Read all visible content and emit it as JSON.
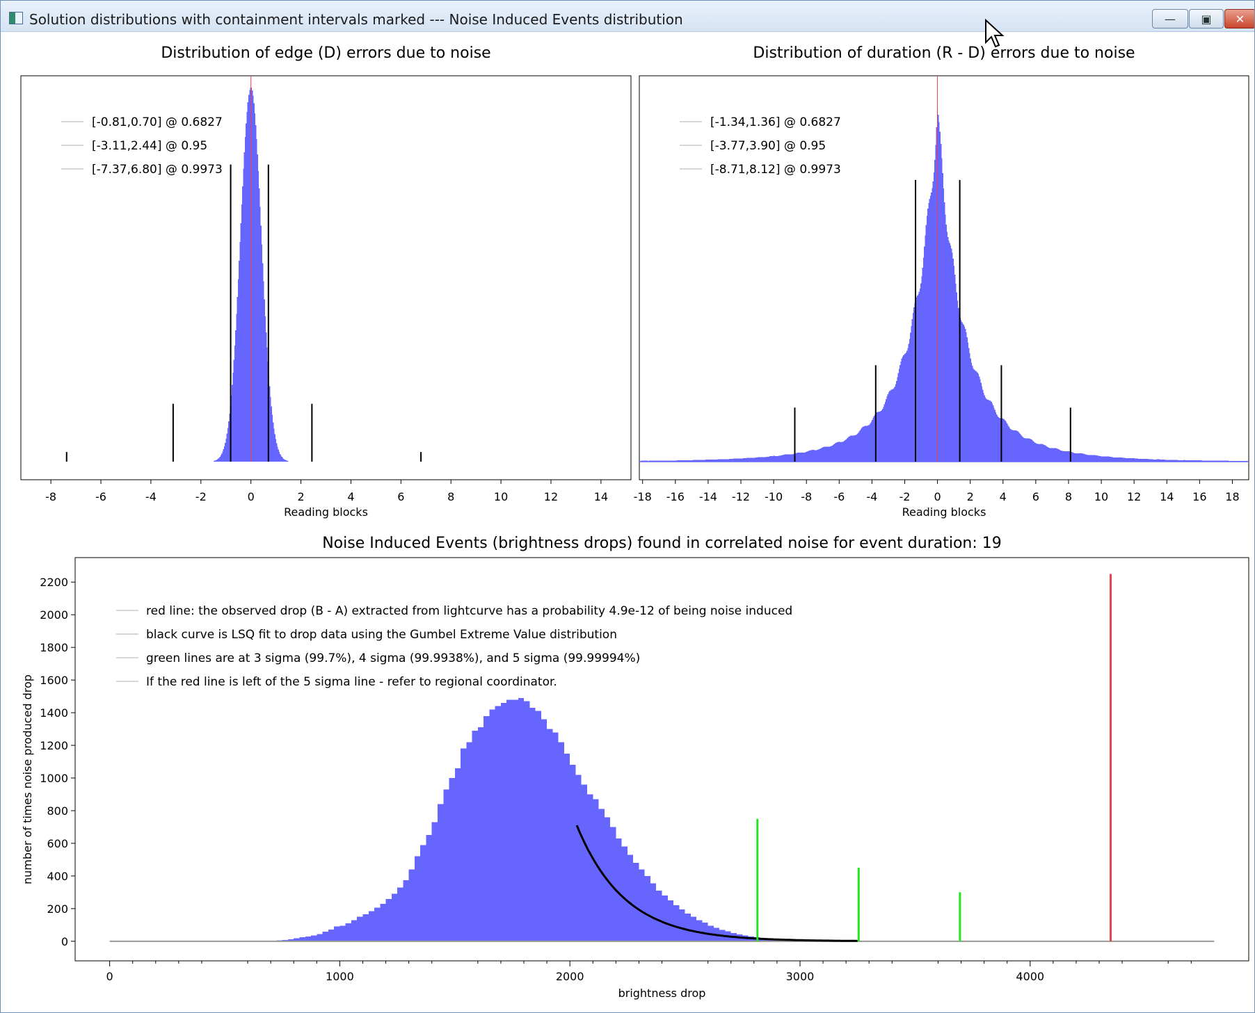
{
  "window": {
    "title": "Solution distributions with containment intervals marked --- Noise Induced Events distribution",
    "minimize_glyph": "—",
    "maximize_glyph": "▣",
    "close_glyph": "✕"
  },
  "colors": {
    "histogram": "#6666ff",
    "interval_lines": "#000000",
    "center_line": "#e8424b",
    "observed_drop_line": "#e8424b",
    "sigma_lines": "#22e622",
    "fit_curve": "#000000",
    "baseline": "#999999"
  },
  "chart_data": [
    {
      "type": "bar",
      "title": "Distribution of edge (D) errors due to noise",
      "xlabel": "Reading blocks",
      "ylabel": "",
      "xlim": [
        -9.2,
        15.2
      ],
      "xticks": [
        -8,
        -6,
        -4,
        -2,
        0,
        2,
        4,
        6,
        8,
        10,
        12,
        14
      ],
      "grid": false,
      "legend_position": "top-left",
      "legend": [
        "[-0.81,0.70] @ 0.6827",
        "[-3.11,2.44] @ 0.95",
        "[-7.37,6.80] @ 0.9973"
      ],
      "histogram": {
        "shape": "normal",
        "center": 0.0,
        "sigma": 0.42,
        "peak_fraction": 0.97
      },
      "center_line": 0,
      "intervals": [
        {
          "confidence": 0.6827,
          "low": -0.81,
          "high": 0.7,
          "height_fraction": 0.77
        },
        {
          "confidence": 0.95,
          "low": -3.11,
          "high": 2.44,
          "height_fraction": 0.15
        },
        {
          "confidence": 0.9973,
          "low": -7.37,
          "high": 6.8,
          "height_fraction": 0.025
        }
      ]
    },
    {
      "type": "bar",
      "title": "Distribution of duration (R - D) errors due to noise",
      "xlabel": "Reading blocks",
      "ylabel": "",
      "xlim": [
        -18.2,
        19.0
      ],
      "xticks": [
        -18,
        -16,
        -14,
        -12,
        -10,
        -8,
        -6,
        -4,
        -2,
        0,
        2,
        4,
        6,
        8,
        10,
        12,
        14,
        16,
        18
      ],
      "grid": false,
      "legend_position": "top-left",
      "legend": [
        "[-1.34,1.36] @ 0.6827",
        "[-3.77,3.90] @ 0.95",
        "[-8.71,8.12] @ 0.9973"
      ],
      "histogram": {
        "shape": "laplace-like",
        "center": 0.0,
        "scale": 1.3,
        "peak_fraction": 0.9,
        "baseline_fraction": 0.05
      },
      "center_line": 0,
      "intervals": [
        {
          "confidence": 0.6827,
          "low": -1.34,
          "high": 1.36,
          "height_fraction": 0.73
        },
        {
          "confidence": 0.95,
          "low": -3.77,
          "high": 3.9,
          "height_fraction": 0.25
        },
        {
          "confidence": 0.9973,
          "low": -8.71,
          "high": 8.12,
          "height_fraction": 0.14
        }
      ]
    },
    {
      "type": "bar",
      "title": "Noise Induced Events (brightness drops) found in correlated noise for event duration: 19",
      "xlabel": "brightness drop",
      "ylabel": "number of times noise produced drop",
      "xlim": [
        -150,
        4950
      ],
      "ylim": [
        -120,
        2350
      ],
      "xticks": [
        0,
        1000,
        2000,
        3000,
        4000
      ],
      "yticks": [
        0,
        200,
        400,
        600,
        800,
        1000,
        1200,
        1400,
        1600,
        1800,
        2000,
        2200
      ],
      "grid": false,
      "legend_position": "top-left",
      "legend": [
        "red line: the observed drop (B - A) extracted from lightcurve has a probability 4.9e-12 of being noise induced",
        "black curve is LSQ fit to drop data using the Gumbel Extreme Value distribution",
        "green lines are at 3 sigma (99.7%), 4 sigma (99.9938%), and 5 sigma (99.99994%)",
        "If the red line is left of the 5 sigma line - refer to regional coordinator."
      ],
      "bin_width": 25,
      "bins_start": 700,
      "counts": [
        2,
        5,
        8,
        12,
        18,
        25,
        30,
        35,
        45,
        58,
        72,
        90,
        95,
        110,
        130,
        150,
        165,
        185,
        205,
        230,
        260,
        290,
        330,
        375,
        440,
        520,
        590,
        650,
        730,
        840,
        930,
        1000,
        1060,
        1180,
        1220,
        1290,
        1310,
        1380,
        1420,
        1440,
        1460,
        1480,
        1480,
        1490,
        1470,
        1430,
        1410,
        1360,
        1300,
        1280,
        1220,
        1150,
        1080,
        1020,
        960,
        900,
        870,
        810,
        760,
        700,
        630,
        580,
        530,
        480,
        440,
        400,
        355,
        310,
        280,
        250,
        220,
        195,
        170,
        150,
        130,
        115,
        95,
        82,
        70,
        60,
        50,
        42,
        35,
        30,
        25,
        20,
        17,
        14,
        12,
        10,
        8,
        7,
        6,
        5,
        4,
        3,
        3,
        2,
        2,
        2,
        1,
        1,
        1
      ],
      "fit_curve": {
        "type": "gumbel-tail",
        "x_start": 2030,
        "x_end": 3250,
        "y_start": 710,
        "y_end": 2
      },
      "sigma_lines": [
        {
          "label": "3 sigma",
          "x": 2815,
          "height": 750
        },
        {
          "label": "4 sigma",
          "x": 3255,
          "height": 450
        },
        {
          "label": "5 sigma",
          "x": 3695,
          "height": 300
        }
      ],
      "observed_drop": {
        "x": 4350,
        "height": 2250
      },
      "baseline_x_range": [
        0,
        4800
      ]
    }
  ]
}
